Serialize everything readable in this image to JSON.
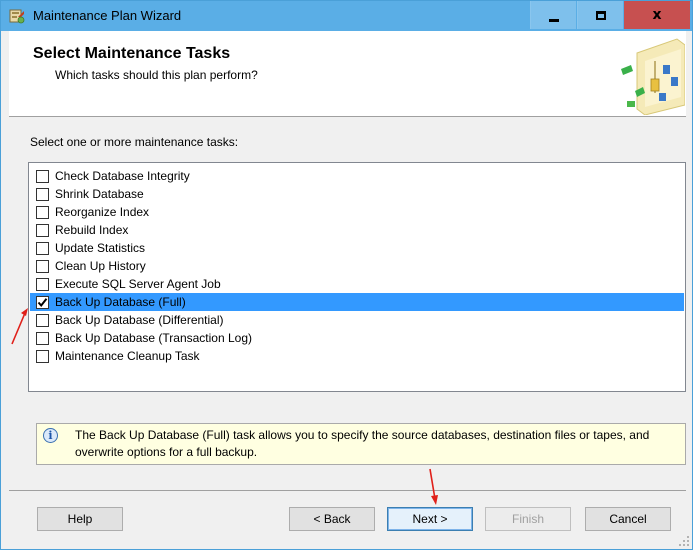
{
  "window": {
    "title": "Maintenance Plan Wizard",
    "close_glyph": "x"
  },
  "header": {
    "title": "Select Maintenance Tasks",
    "subtitle": "Which tasks should this plan perform?"
  },
  "prompt": "Select one or more maintenance tasks:",
  "tasks": [
    {
      "label": "Check Database Integrity",
      "checked": false,
      "selected": false
    },
    {
      "label": "Shrink Database",
      "checked": false,
      "selected": false
    },
    {
      "label": "Reorganize Index",
      "checked": false,
      "selected": false
    },
    {
      "label": "Rebuild Index",
      "checked": false,
      "selected": false
    },
    {
      "label": "Update Statistics",
      "checked": false,
      "selected": false
    },
    {
      "label": "Clean Up History",
      "checked": false,
      "selected": false
    },
    {
      "label": "Execute SQL Server Agent Job",
      "checked": false,
      "selected": false
    },
    {
      "label": "Back Up Database (Full)",
      "checked": true,
      "selected": true
    },
    {
      "label": "Back Up Database (Differential)",
      "checked": false,
      "selected": false
    },
    {
      "label": "Back Up Database (Transaction Log)",
      "checked": false,
      "selected": false
    },
    {
      "label": "Maintenance Cleanup Task",
      "checked": false,
      "selected": false
    }
  ],
  "description": "The Back Up Database (Full) task allows you to specify the source databases, destination files or tapes, and overwrite options for a full backup.",
  "buttons": {
    "help": "Help",
    "back": "< Back",
    "next": "Next >",
    "finish": "Finish",
    "cancel": "Cancel"
  },
  "colors": {
    "titlebar": "#5aaee6",
    "selection": "#3399ff",
    "annotation_arrow": "#e0201a"
  }
}
